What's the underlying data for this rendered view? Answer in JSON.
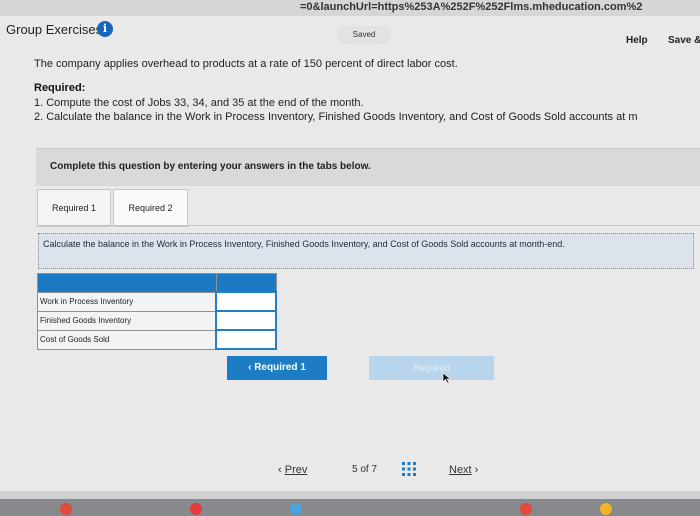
{
  "browser": {
    "url": "=0&launchUrl=https%253A%252F%252Flms.mheducation.com%2"
  },
  "header": {
    "title": "Group Exercises",
    "info_icon": "i",
    "saved": "Saved",
    "help": "Help",
    "save_exit": "Save &"
  },
  "question": {
    "intro": "The company applies overhead to products at a rate of 150 percent of direct labor cost.",
    "required_heading": "Required:",
    "required_items": [
      "1. Compute the cost of Jobs 33, 34, and 35 at the end of the month.",
      "2. Calculate the balance in the Work in Process Inventory, Finished Goods Inventory, and Cost of Goods Sold accounts at m"
    ]
  },
  "instructions": "Complete this question by entering your answers in the tabs below.",
  "tabs": [
    "Required 1",
    "Required 2"
  ],
  "task": "Calculate the balance in the Work in Process Inventory, Finished Goods Inventory, and Cost of Goods Sold accounts at month-end.",
  "balance_table": {
    "rows": [
      {
        "label": "Work in Process Inventory",
        "value": ""
      },
      {
        "label": "Finished Goods Inventory",
        "value": ""
      },
      {
        "label": "Cost of Goods Sold",
        "value": ""
      }
    ]
  },
  "nav_buttons": {
    "prev_required": "Required 1",
    "next_required": "Required"
  },
  "pager": {
    "prev": "Prev",
    "page_text": "5 of 7",
    "next": "Next"
  },
  "colors": {
    "accent": "#1c7cc4",
    "disabled_button": "#b9d5ec"
  }
}
